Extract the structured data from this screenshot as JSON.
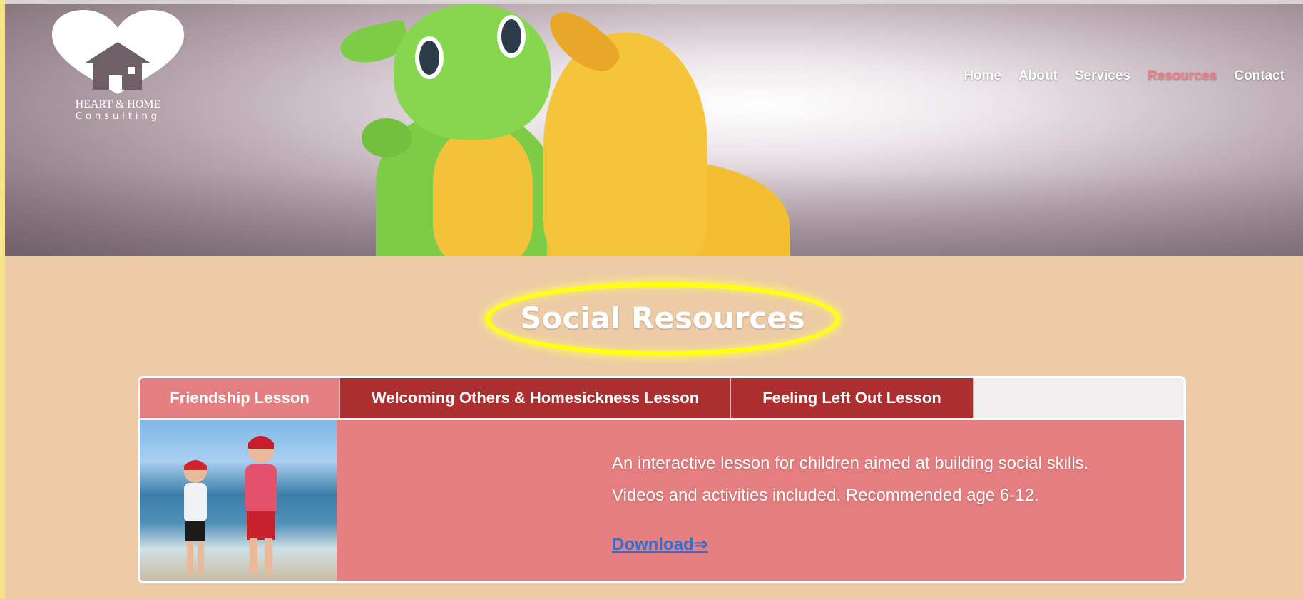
{
  "brand": {
    "line1": "HEART & HOME",
    "line2": "Consulting"
  },
  "nav": {
    "items": [
      {
        "label": "Home"
      },
      {
        "label": "About"
      },
      {
        "label": "Services"
      },
      {
        "label": "Resources",
        "active": true
      },
      {
        "label": "Contact"
      }
    ]
  },
  "page_title": "Social Resources",
  "tabs": [
    {
      "label": "Friendship Lesson",
      "active": true
    },
    {
      "label": "Welcoming Others & Homesickness Lesson"
    },
    {
      "label": "Feeling Left Out Lesson"
    }
  ],
  "lesson": {
    "description_line1": "An interactive lesson for children aimed at building social skills.",
    "description_line2": "Videos and activities included. Recommended age 6-12.",
    "download_label": "Download⇒"
  },
  "colors": {
    "accent_active": "#ef7f86",
    "tab_bg": "#ac2f2f",
    "tab_active_bg": "#e47e80",
    "title_highlight": "#ffff14",
    "link": "#2f6fd3"
  },
  "icons": [
    "heart-home-logo",
    "house-icon"
  ]
}
